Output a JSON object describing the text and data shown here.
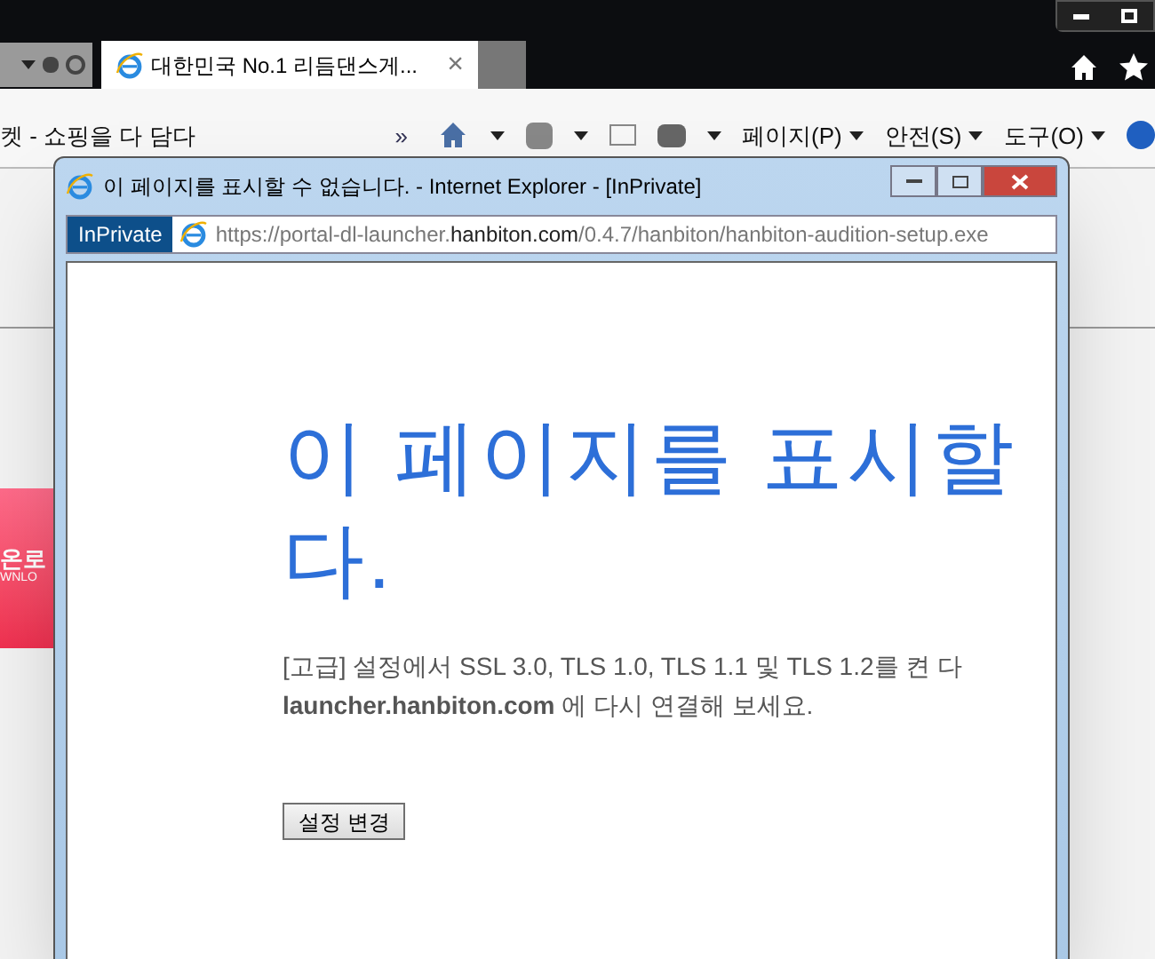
{
  "browser": {
    "tab": {
      "title": "대한민국 No.1 리듬댄스게...",
      "close": "×"
    },
    "page_title": "켓 - 쇼핑을 다 담다",
    "overflow": "»",
    "commands": [
      {
        "label": "페이지(P)"
      },
      {
        "label": "안전(S)"
      },
      {
        "label": "도구(O)"
      }
    ],
    "banner": {
      "title": "온로",
      "subtitle": "WNLO"
    }
  },
  "window": {
    "title": "이 페이지를 표시할 수 없습니다. - Internet Explorer - [InPrivate]",
    "badge": "InPrivate",
    "address": {
      "prefix": "https://portal-dl-launcher.",
      "domain": "hanbiton.com",
      "suffix": "/0.4.7/hanbiton/hanbiton-audition-setup.exe"
    },
    "heading_lines": [
      "이 페이지를 표시할",
      "다."
    ],
    "message_lines": [
      "[고급] 설정에서 SSL 3.0, TLS 1.0, TLS 1.1 및 TLS 1.2를 켠 다",
      "**launcher.hanbiton.com** 에 다시 연결해 보세요."
    ],
    "button": "설정 변경"
  }
}
